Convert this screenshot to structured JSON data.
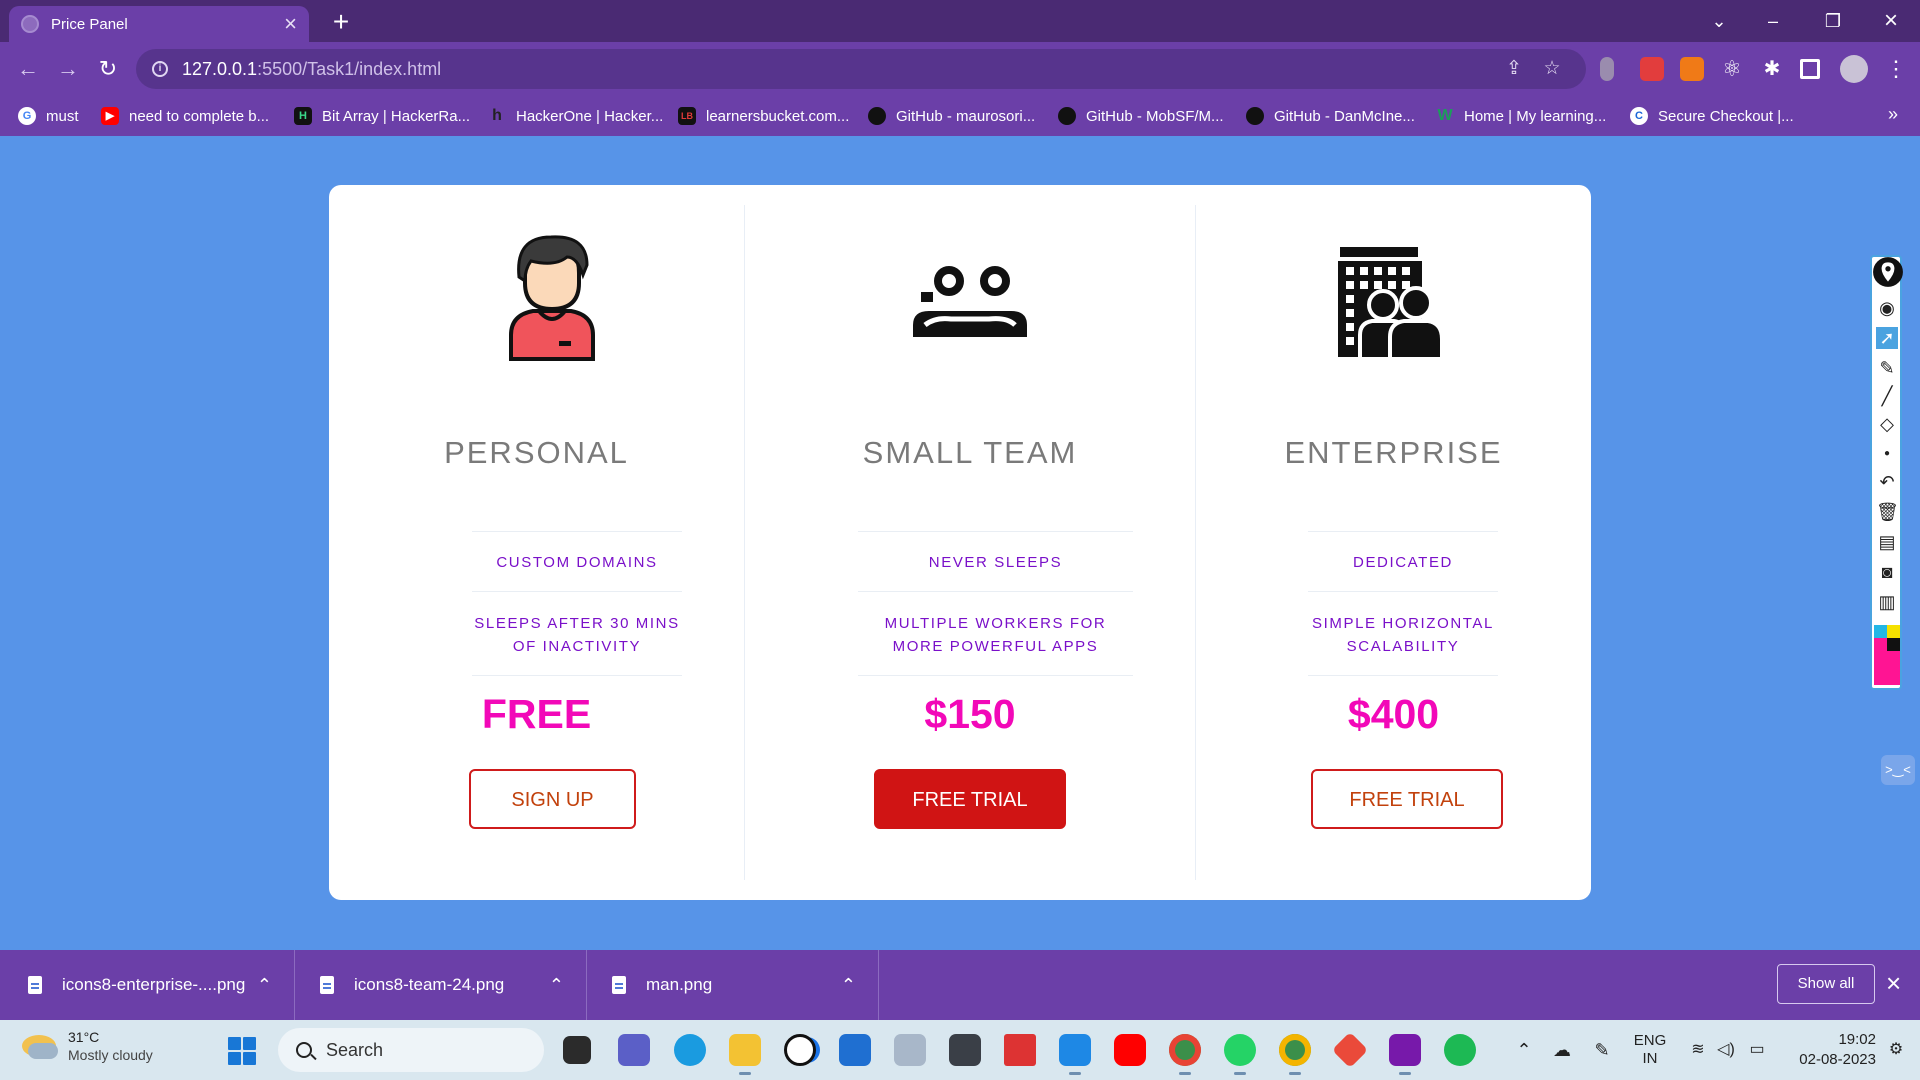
{
  "browser": {
    "tab_title": "Price Panel",
    "url_host": "127.0.0.1",
    "url_path": ":5500/Task1/index.html",
    "bookmarks": [
      {
        "label": "must",
        "color": "#ffffff"
      },
      {
        "label": "need to complete b...",
        "color": "#ff0000"
      },
      {
        "label": "Bit Array | HackerRa...",
        "color": "#111111"
      },
      {
        "label": "HackerOne | Hacker...",
        "color": "#333333"
      },
      {
        "label": "learnersbucket.com...",
        "color": "#111111"
      },
      {
        "label": "GitHub - maurosori...",
        "color": "#111111"
      },
      {
        "label": "GitHub - MobSF/M...",
        "color": "#111111"
      },
      {
        "label": "GitHub - DanMcIne...",
        "color": "#111111"
      },
      {
        "label": "Home | My learning...",
        "color": "#1b9e5a"
      },
      {
        "label": "Secure Checkout |...",
        "color": "#1a66d8"
      }
    ]
  },
  "plans": [
    {
      "icon": "person-icon",
      "title": "PERSONAL",
      "features": [
        "CUSTOM DOMAINS",
        "SLEEPS AFTER 30 MINS OF INACTIVITY"
      ],
      "price": "FREE",
      "button": "SIGN UP",
      "button_style": "outline"
    },
    {
      "icon": "team-icon",
      "title": "SMALL TEAM",
      "features": [
        "NEVER SLEEPS",
        "MULTIPLE WORKERS FOR MORE POWERFUL APPS"
      ],
      "price": "$150",
      "button": "FREE TRIAL",
      "button_style": "solid"
    },
    {
      "icon": "enterprise-icon",
      "title": "ENTERPRISE",
      "features": [
        "DEDICATED",
        "SIMPLE HORIZONTAL SCALABILITY"
      ],
      "price": "$400",
      "button": "FREE TRIAL",
      "button_style": "outline"
    }
  ],
  "downloads": {
    "items": [
      "icons8-enterprise-....png",
      "icons8-team-24.png",
      "man.png"
    ],
    "show_all": "Show all"
  },
  "taskbar": {
    "temperature": "31°C",
    "weather": "Mostly cloudy",
    "search_placeholder": "Search",
    "language": "ENG",
    "region": "IN",
    "time": "19:02",
    "date": "02-08-2023"
  },
  "colors": {
    "page_bg": "#5794e8",
    "accent_purple": "#7a10c9",
    "price_pink": "#f208b8",
    "button_red": "#d01414"
  }
}
